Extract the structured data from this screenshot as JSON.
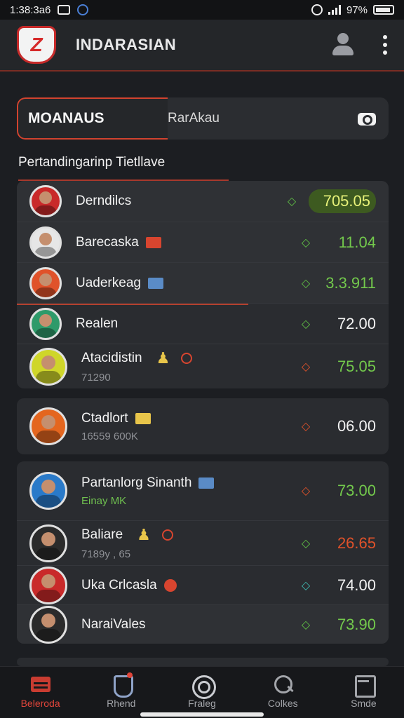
{
  "status_bar": {
    "time": "1:38:3a6",
    "battery": "97%"
  },
  "app": {
    "title": "INDARASIAN",
    "logo_text": "Z"
  },
  "search": {
    "segment_label": "MOANAUS",
    "placeholder": "RarAkau"
  },
  "section": {
    "title": "Pertandingarinp Tietllave"
  },
  "groups": [
    {
      "rows": [
        {
          "name": "Derndilcs",
          "sub": "",
          "odds": "705.05",
          "trend": "◇",
          "trend_color": "#5fbf45",
          "odds_color": "#e8f27a",
          "highlight_odds": true,
          "avatar_color": "#c92a2a",
          "flag_color": ""
        },
        {
          "name": "Barecaska",
          "sub": "",
          "odds": "11.04",
          "trend": "◇",
          "trend_color": "#5fbf45",
          "odds_color": "#73c94c",
          "avatar_color": "#e6e6e6",
          "flag_color": "#d8452f"
        },
        {
          "name": "Uaderkeag",
          "sub": "",
          "odds": "3.3.911",
          "trend": "◇",
          "trend_color": "#5fbf45",
          "odds_color": "#73c94c",
          "avatar_color": "#e0522a",
          "flag_color": "#5a8bc6"
        },
        {
          "name": "Realen",
          "sub": "",
          "odds": "72.00",
          "trend": "◇",
          "trend_color": "#5fbf45",
          "odds_color": "#f2f2f2",
          "avatar_color": "#2e9a6a",
          "flag_color": ""
        },
        {
          "name": "Atacidistin",
          "sub": "71290",
          "odds": "75.05",
          "trend": "◇",
          "trend_color": "#e0522a",
          "odds_color": "#73c94c",
          "avatar_color": "#cfd62a",
          "flag_color": "",
          "figure": true
        }
      ]
    },
    {
      "rows": [
        {
          "name": "Ctadlort",
          "sub": "16559 600K",
          "odds": "06.00",
          "trend": "◇",
          "trend_color": "#e0522a",
          "odds_color": "#f2f2f2",
          "avatar_color": "#e4661f",
          "flag_color": "#e8c54a"
        }
      ]
    },
    {
      "rows": [
        {
          "name": "Partanlorg Sinanth",
          "sub": "Einay MK",
          "sub_green": true,
          "odds": "73.00",
          "trend": "◇",
          "trend_color": "#e0522a",
          "odds_color": "#73c94c",
          "avatar_color": "#2a7ac9",
          "flag_color": "#5a8bc6"
        },
        {
          "name": "Baliare",
          "sub": "7189y , 65",
          "odds": "26.65",
          "trend": "◇",
          "trend_color": "#5fbf45",
          "odds_color": "#e0522a",
          "avatar_color": "#2b2b2b",
          "flag_color": "",
          "figure": true
        },
        {
          "name": "Uka Crlcasla",
          "sub": "",
          "odds": "74.00",
          "trend": "◇",
          "trend_color": "#3fb8b0",
          "odds_color": "#f2f2f2",
          "avatar_color": "#c92a2a",
          "flag_color": "#d8452f",
          "flag_round": true
        },
        {
          "name": "NaraiVales",
          "sub": "",
          "odds": "73.90",
          "trend": "◇",
          "trend_color": "#5fbf45",
          "odds_color": "#73c94c",
          "avatar_color": "#2b2b2b",
          "flag_color": ""
        }
      ]
    }
  ],
  "nav": [
    {
      "label": "Beleroda",
      "icon": "home-icon",
      "active": true
    },
    {
      "label": "Rhend",
      "icon": "shield-icon",
      "active": false
    },
    {
      "label": "Fraleg",
      "icon": "ball-icon",
      "active": false
    },
    {
      "label": "Colkes",
      "icon": "search-icon",
      "active": false
    },
    {
      "label": "Smde",
      "icon": "document-icon",
      "active": false
    }
  ]
}
